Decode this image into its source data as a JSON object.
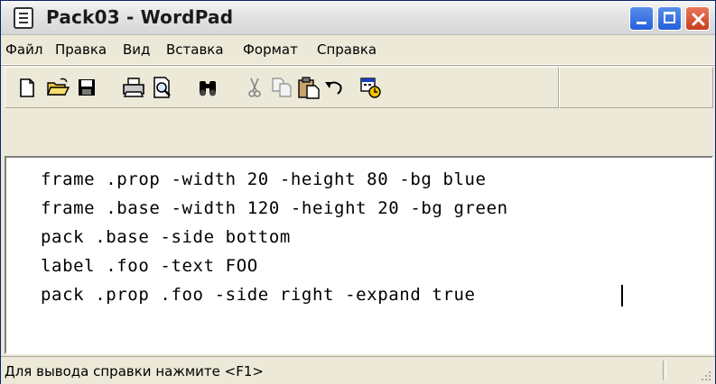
{
  "window": {
    "title": "Pack03 - WordPad",
    "icon": "wordpad-document-icon"
  },
  "menu": {
    "items": [
      {
        "label": "Файл"
      },
      {
        "label": "Правка"
      },
      {
        "label": "Вид"
      },
      {
        "label": "Вставка"
      },
      {
        "label": "Формат"
      },
      {
        "label": "Справка"
      }
    ]
  },
  "toolbar": {
    "icons": [
      "new-document-icon",
      "open-folder-icon",
      "save-disk-icon",
      "print-icon",
      "print-preview-icon",
      "find-binoculars-icon",
      "cut-scissors-icon",
      "copy-icon",
      "paste-clipboard-icon",
      "undo-icon",
      "date-time-icon"
    ]
  },
  "document": {
    "lines": [
      "frame .prop -width 20 -height 80 -bg blue",
      "frame .base -width 120 -height 20 -bg green",
      "pack .base -side bottom",
      "label .foo -text FOO",
      "pack .prop .foo -side right -expand true"
    ]
  },
  "status": {
    "text": "Для вывода справки нажмите <F1>"
  },
  "colors": {
    "titlebar": "#e6e6e6",
    "close_button": "#c53e1b",
    "caption_button": "#245edb",
    "chrome": "#ece9d8"
  }
}
